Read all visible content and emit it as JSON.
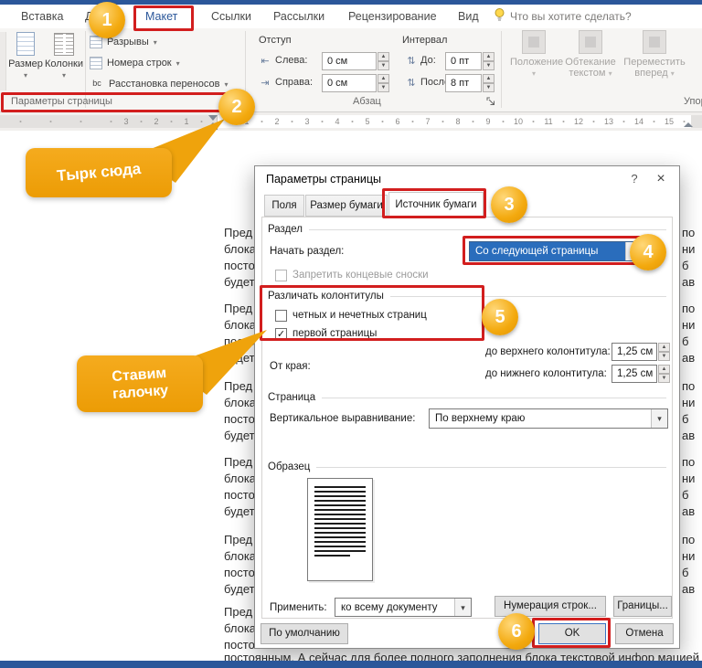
{
  "ribbon": {
    "tabs": [
      "Вставка",
      "Дизайн",
      "Макет",
      "Ссылки",
      "Рассылки",
      "Рецензирование",
      "Вид"
    ],
    "tell_me": "Что вы хотите сделать?",
    "size": "Размер",
    "columns": "Колонки",
    "breaks": "Разрывы",
    "line_numbers": "Номера строк",
    "hyphenation": "Расстановка переносов",
    "hyphenation_icon": "bc",
    "page_setup_group": "Параметры страницы",
    "paragraph": {
      "indent_header": "Отступ",
      "spacing_header": "Интервал",
      "left_label": "Слева:",
      "right_label": "Справа:",
      "before_label": "До:",
      "after_label": "После:",
      "left_value": "0 см",
      "right_value": "0 см",
      "before_value": "0 пт",
      "after_value": "8 пт",
      "group_label": "Абзац"
    },
    "arrange": {
      "position": "Положение",
      "wrap_text": "Обтекание текстом",
      "bring_forward": "Переместить вперед",
      "group_label_cut": "Упор"
    }
  },
  "ruler": {
    "left": [
      "3",
      "2",
      "1"
    ],
    "right": [
      "1",
      "2",
      "3",
      "4",
      "5",
      "6",
      "7",
      "8",
      "9",
      "10",
      "11",
      "12",
      "13",
      "14",
      "15"
    ]
  },
  "dialog": {
    "title": "Параметры страницы",
    "help": "?",
    "close": "×",
    "tabs": [
      "Поля",
      "Размер бумаги",
      "Источник бумаги"
    ],
    "section": {
      "header": "Раздел",
      "start_label": "Начать раздел:",
      "start_value": "Со следующей страницы",
      "suppress_endnotes": "Запретить концевые сноски"
    },
    "headers_footers": {
      "header": "Различать колонтитулы",
      "odd_even": "четных и нечетных страниц",
      "first_page": "первой страницы",
      "from_edge": "От края:",
      "header_label": "до верхнего колонтитула:",
      "header_value": "1,25 см",
      "footer_label": "до нижнего колонтитула:",
      "footer_value": "1,25 см"
    },
    "page": {
      "header": "Страница",
      "valign_label": "Вертикальное выравнивание:",
      "valign_value": "По верхнему краю"
    },
    "sample": {
      "header": "Образец",
      "apply_label": "Применить:",
      "apply_value": "ко всему документу"
    },
    "buttons": {
      "line_numbering": "Нумерация строк...",
      "borders": "Границы...",
      "default": "По умолчанию",
      "ok": "OK",
      "cancel": "Отмена"
    }
  },
  "annotations": {
    "badges": [
      "1",
      "2",
      "3",
      "4",
      "5",
      "6"
    ],
    "callout_click": "Тырк сюда",
    "callout_check": "Ставим галочку"
  },
  "document": {
    "para_lines": [
      "Пред",
      "блока",
      "посто",
      "будет"
    ],
    "right_bits": [
      "по",
      "ни",
      "б",
      "ав"
    ],
    "bottom_line_a": "постоянным. А сейчас для более полного заполнения блока текстовой ",
    "bottom_line_b": "инфор мацией"
  },
  "colors": {
    "brand_blue": "#2b579a",
    "annotation_red": "#d21e1e",
    "annotation_orange": "#f0a30c",
    "selection_blue": "#2a6dbc"
  }
}
